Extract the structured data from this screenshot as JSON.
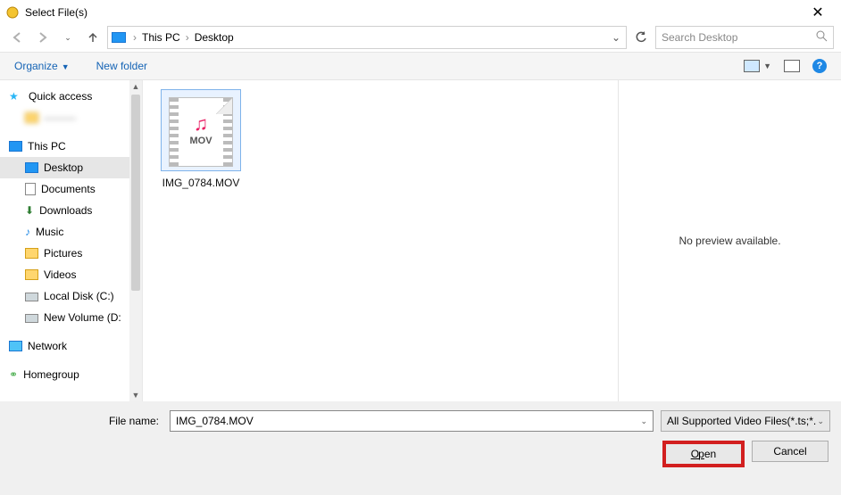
{
  "title": "Select File(s)",
  "breadcrumb": {
    "root": "This PC",
    "current": "Desktop"
  },
  "search": {
    "placeholder": "Search Desktop"
  },
  "toolbar": {
    "organize": "Organize",
    "newfolder": "New folder"
  },
  "sidebar": {
    "quick": "Quick access",
    "blurred": "———",
    "thispc": "This PC",
    "items": [
      {
        "label": "Desktop"
      },
      {
        "label": "Documents"
      },
      {
        "label": "Downloads"
      },
      {
        "label": "Music"
      },
      {
        "label": "Pictures"
      },
      {
        "label": "Videos"
      },
      {
        "label": "Local Disk (C:)"
      },
      {
        "label": "New Volume (D:"
      }
    ],
    "network": "Network",
    "homegroup": "Homegroup"
  },
  "file": {
    "name": "IMG_0784.MOV",
    "format": "MOV"
  },
  "preview": {
    "msg": "No preview available."
  },
  "footer": {
    "fnlabel": "File name:",
    "fnvalue": "IMG_0784.MOV",
    "filter": "All Supported Video Files(*.ts;*.",
    "open": "Open",
    "cancel": "Cancel"
  }
}
